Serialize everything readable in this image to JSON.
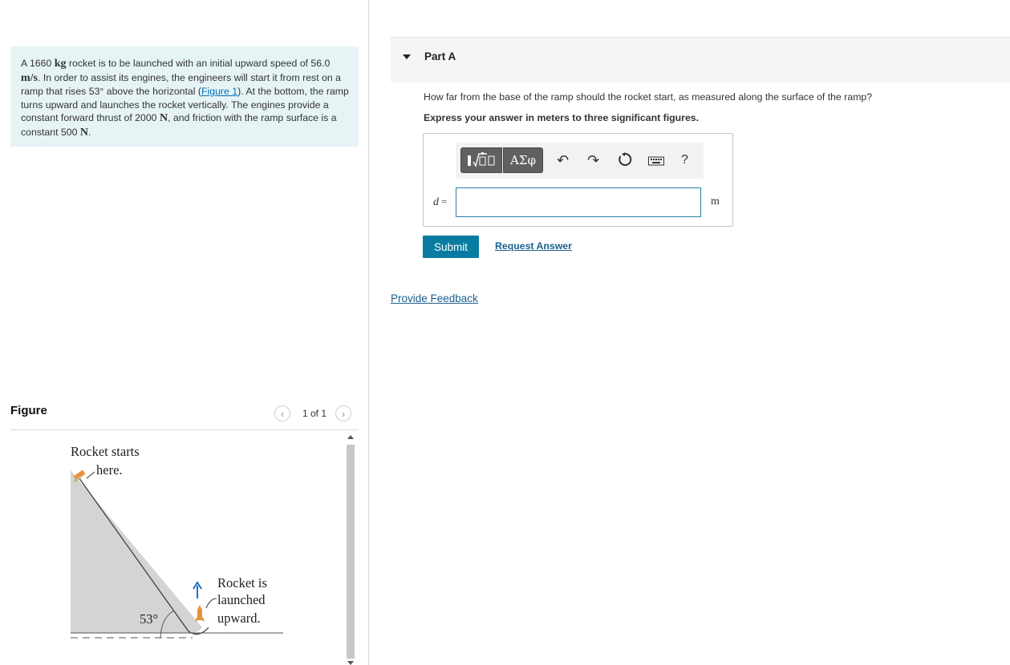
{
  "problem": {
    "t1": "A 1660 ",
    "u_kg": "kg",
    "t2": " rocket is to be launched with an initial upward speed of ",
    "t3": "56.0 ",
    "u_ms": "m/s",
    "t4": ". In order to assist its engines, the engineers will start it from rest on a ramp that rises 53° above the horizontal (",
    "figure_link": "Figure 1",
    "t5": "). At the bottom, the ramp turns upward and launches the rocket vertically. The engines provide a constant forward thrust of 2000 ",
    "u_n1": "N",
    "t6": ", and friction with the ramp surface is a constant 500 ",
    "u_n2": "N",
    "t7": "."
  },
  "figure": {
    "title": "Figure",
    "pager_text": "1 of 1",
    "prev_icon": "chevron-left-icon",
    "next_icon": "chevron-right-icon",
    "label_start_line1": "Rocket starts",
    "label_start_line2": "here.",
    "label_launch_line1": "Rocket is",
    "label_launch_line2": "launched",
    "label_launch_line3": "upward.",
    "angle_label": "53°"
  },
  "part": {
    "title": "Part A",
    "question": "How far from the base of the ramp should the rocket start, as measured along the surface of the ramp?",
    "instruction": "Express your answer in meters to three significant figures.",
    "variable": "d",
    "equals": " =",
    "answer_value": "",
    "unit": "m",
    "greek_label": "ΑΣφ",
    "help_label": "?",
    "submit_label": "Submit",
    "request_label": "Request Answer"
  },
  "feedback_label": "Provide Feedback",
  "colors": {
    "problem_bg": "#e7f4f6",
    "submit_bg": "#087ca1",
    "link": "#1a5f8c",
    "ramp_fill": "#d4d4d4",
    "arrow": "#1f6fc4",
    "rocket": "#e8923a"
  }
}
